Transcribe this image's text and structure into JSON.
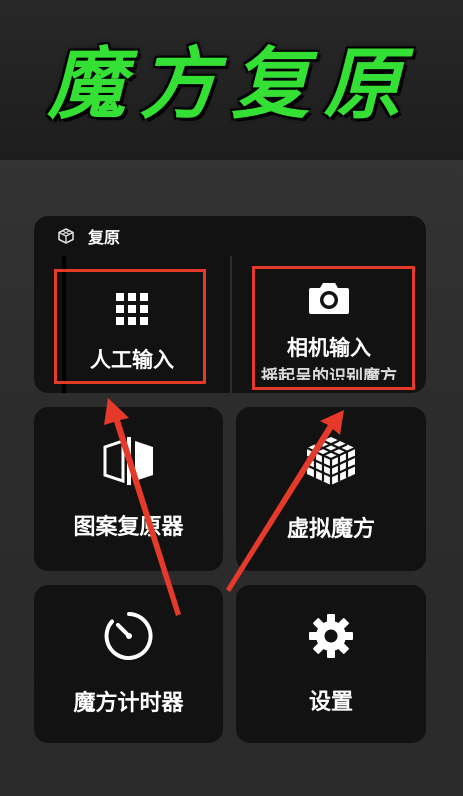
{
  "header": {
    "title": "魔方复原"
  },
  "restore_section": {
    "title": "复原",
    "title_icon": "cube-outline-icon",
    "manual_input": {
      "label": "人工输入",
      "icon": "grid-icon"
    },
    "camera_input": {
      "label": "相机输入",
      "sublabel": "摇起呈的识别魔方",
      "icon": "camera-icon"
    }
  },
  "tiles": [
    {
      "label": "图案复原器",
      "icon": "pattern-mirror-icon"
    },
    {
      "label": "虚拟魔方",
      "icon": "rubiks-cube-icon"
    },
    {
      "label": "魔方计时器",
      "icon": "timer-icon"
    },
    {
      "label": "设置",
      "icon": "gear-icon"
    }
  ],
  "annotations": {
    "highlight_color": "#e53a2a",
    "arrow_color": "#e53a2a"
  },
  "colors": {
    "title_green": "#34e034",
    "card_bg": "#121212",
    "page_bg": "#2a2a2a"
  }
}
